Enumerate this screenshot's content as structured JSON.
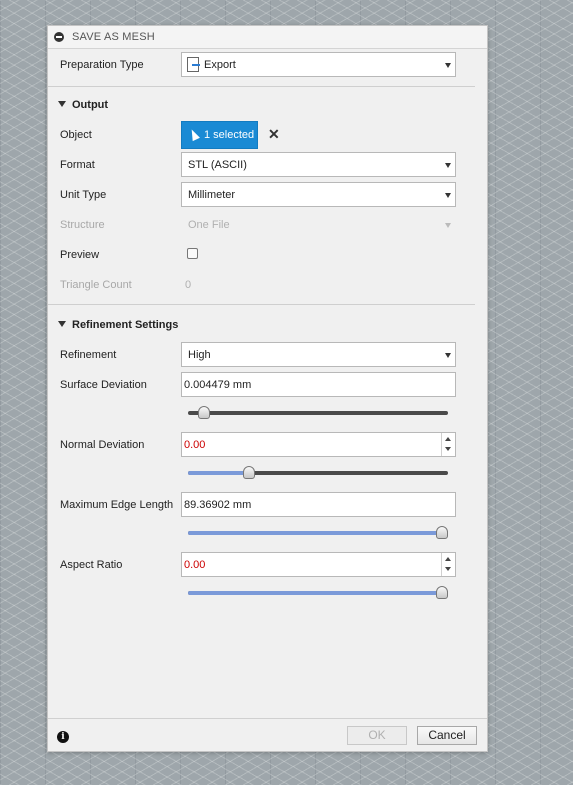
{
  "dialog": {
    "title": "SAVE AS MESH",
    "preparation_type": {
      "label": "Preparation Type",
      "value": "Export",
      "icon": "export-icon"
    },
    "output": {
      "header": "Output",
      "object": {
        "label": "Object",
        "button": "1 selected",
        "clear": "✕"
      },
      "format": {
        "label": "Format",
        "value": "STL (ASCII)"
      },
      "unit_type": {
        "label": "Unit Type",
        "value": "Millimeter"
      },
      "structure": {
        "label": "Structure",
        "value": "One File"
      },
      "preview": {
        "label": "Preview",
        "checked": false
      },
      "triangle_count": {
        "label": "Triangle Count",
        "value": "0"
      }
    },
    "refinement": {
      "header": "Refinement Settings",
      "refinement": {
        "label": "Refinement",
        "value": "High"
      },
      "surface_deviation": {
        "label": "Surface Deviation",
        "value": "0.004479 mm",
        "slider": 0.04
      },
      "normal_deviation": {
        "label": "Normal Deviation",
        "value": "0.00",
        "slider": 0.22
      },
      "max_edge_length": {
        "label": "Maximum Edge Length",
        "value": "89.36902 mm",
        "slider": 1.0
      },
      "aspect_ratio": {
        "label": "Aspect Ratio",
        "value": "0.00",
        "slider": 1.0
      }
    },
    "footer": {
      "info": "i",
      "ok": "OK",
      "cancel": "Cancel"
    }
  }
}
